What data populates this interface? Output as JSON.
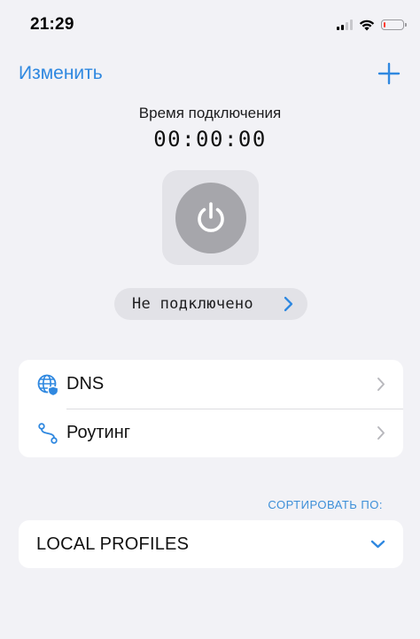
{
  "status_bar": {
    "time": "21:29",
    "icons": [
      "cellular-signal-icon",
      "wifi-icon",
      "battery-icon"
    ],
    "battery_level": 0.1,
    "battery_color": "#ff3b30"
  },
  "nav": {
    "edit_label": "Изменить",
    "add_icon": "plus-icon",
    "accent": "#2f88e0"
  },
  "connection": {
    "title": "Время подключения",
    "timer": "00:00:00",
    "power_icon": "power-icon",
    "status_label": "Не подключено",
    "status_icon": "chevron-right-icon"
  },
  "settings_list": {
    "items": [
      {
        "label": "DNS",
        "icon": "globe-shield-icon"
      },
      {
        "label": "Роутинг",
        "icon": "route-icon"
      }
    ]
  },
  "profiles": {
    "sort_label": "СОРТИРОВАТЬ ПО:",
    "selected": "LOCAL PROFILES",
    "dropdown_icon": "chevron-down-icon"
  }
}
